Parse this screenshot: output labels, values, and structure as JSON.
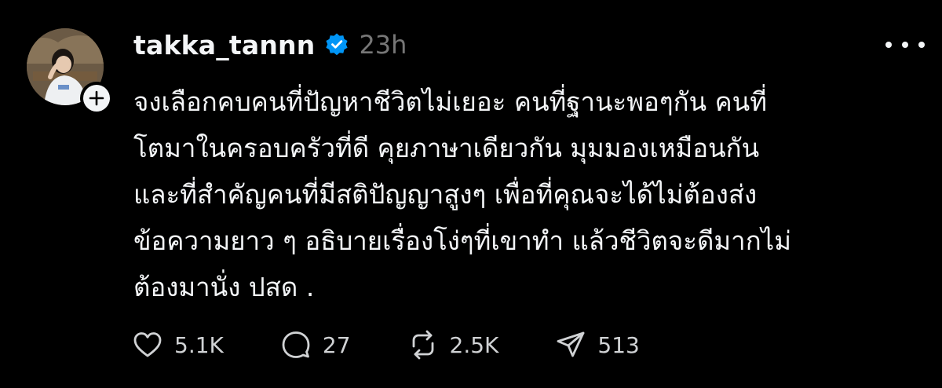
{
  "post": {
    "username": "takka_tannn",
    "time": "23h",
    "verified": true,
    "accent_color": "#0095f6",
    "text_lines": [
      "จงเลือกคบคนที่ปัญหาชีวิตไม่เยอะ คนที่ฐานะพอๆกัน คนที่",
      "โตมาในครอบครัวที่ดี คุยภาษาเดียวกัน มุมมองเหมือนกัน",
      "และที่สำคัญคนที่มีสติปัญญาสูงๆ เพื่อที่คุณจะได้ไม่ต้องส่ง",
      "ข้อความยาว ๆ อธิบายเรื่องโง่ๆที่เขาทำ แล้วชีวิตจะดีมากไม่",
      "ต้องมานั่ง ปสด ."
    ]
  },
  "actions": {
    "likes": "5.1K",
    "replies": "27",
    "reposts": "2.5K",
    "shares": "513"
  },
  "icons": {
    "like": "heart-icon",
    "reply": "comment-icon",
    "repost": "repost-icon",
    "share": "send-icon",
    "more": "more-icon",
    "follow": "plus-icon",
    "verified": "verified-badge-icon"
  }
}
